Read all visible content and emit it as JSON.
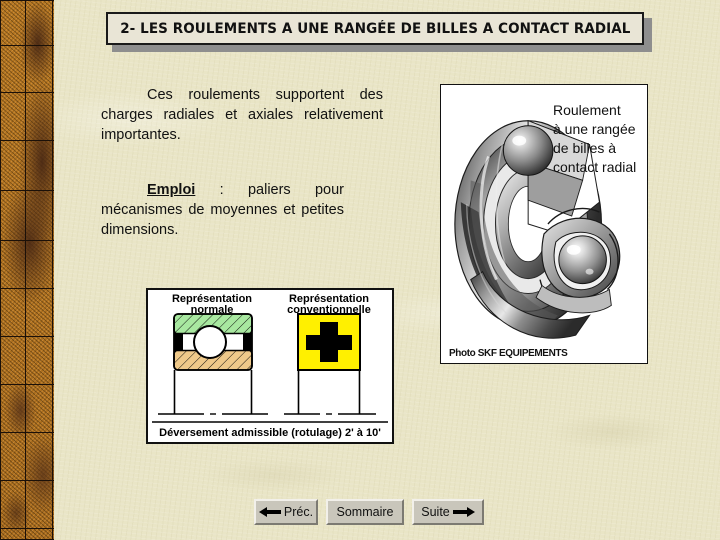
{
  "slide": {
    "title": "2- LES ROULEMENTS A UNE RANGÉE DE BILLES A CONTACT RADIAL",
    "background_color": "#e9e5c6",
    "left_band_color": "#a96c1c"
  },
  "content": {
    "paragraph_1": "Ces roulements supportent des charges radiales et axiales relativement importantes.",
    "paragraph_2_label": "Emploi",
    "paragraph_2_separator": " : ",
    "paragraph_2_text": "paliers pour mécanismes de moyennes et petites dimensions."
  },
  "photo": {
    "label_line_1": "Roulement",
    "label_line_2": "à une rangée",
    "label_line_3": "de billes à",
    "label_line_4": "contact radial",
    "caption": "Photo SKF EQUIPEMENTS",
    "alt": "ball-bearing-cutaway-photo"
  },
  "diagram": {
    "heading_left_line_1": "Représentation",
    "heading_left_line_2": "normale",
    "heading_right_line_1": "Représentation",
    "heading_right_line_2": "conventionnelle",
    "symbol_conventional": "+",
    "caption": "Déversement admissible (rotulage) 2' à 10'",
    "colors": {
      "outer_ring": "#a8e8a0",
      "inner_ring": "#efc98a",
      "conventional_square": "#fff000",
      "line": "#000000"
    }
  },
  "nav": {
    "prev_label": "Préc.",
    "home_label": "Sommaire",
    "next_label": "Suite"
  }
}
